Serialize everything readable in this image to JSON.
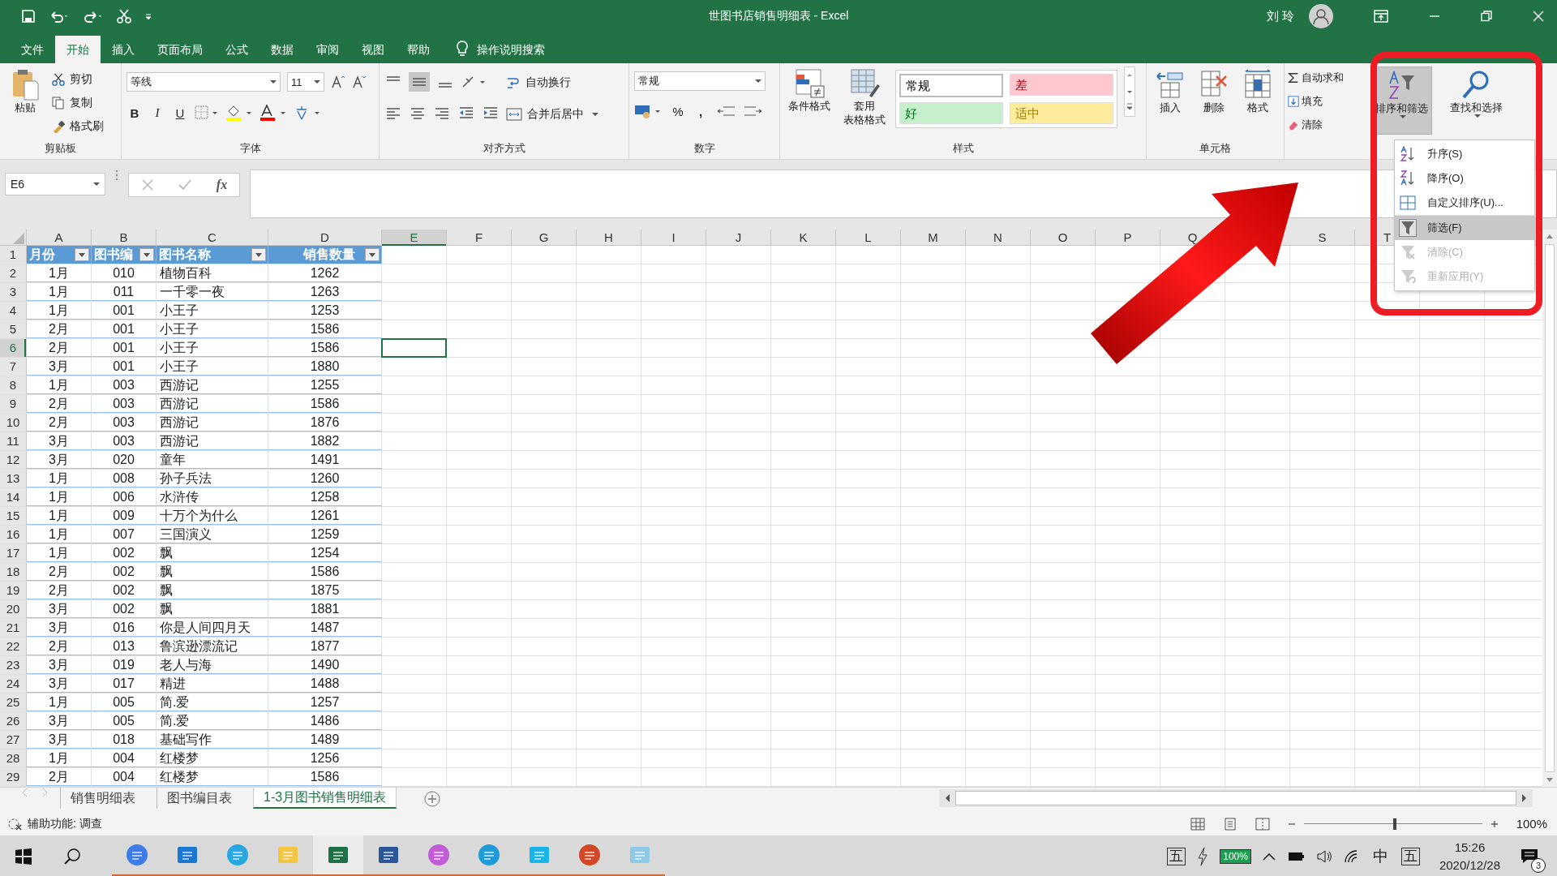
{
  "title_bar": {
    "title": "世图书店销售明细表  -  Excel",
    "user": "刘 玲"
  },
  "menu_tabs": [
    {
      "label": "文件",
      "selected": false
    },
    {
      "label": "开始",
      "selected": true
    },
    {
      "label": "插入",
      "selected": false
    },
    {
      "label": "页面布局",
      "selected": false
    },
    {
      "label": "公式",
      "selected": false
    },
    {
      "label": "数据",
      "selected": false
    },
    {
      "label": "审阅",
      "selected": false
    },
    {
      "label": "视图",
      "selected": false
    },
    {
      "label": "帮助",
      "selected": false
    }
  ],
  "tell_me": "操作说明搜索",
  "ribbon": {
    "clipboard": {
      "label": "剪贴板",
      "paste": "粘贴",
      "cut": "剪切",
      "copy": "复制",
      "painter": "格式刷"
    },
    "font": {
      "label": "字体",
      "family": "等线",
      "size": "11",
      "bold": "B",
      "italic": "I",
      "underline": "U"
    },
    "alignment": {
      "label": "对齐方式",
      "wrap": "自动换行",
      "merge": "合并后居中"
    },
    "number": {
      "label": "数字",
      "format": "常规",
      "percent": "%",
      "comma": ","
    },
    "styles": {
      "label": "样式",
      "conditional": "条件格式",
      "table_format": [
        "套用",
        "表格格式"
      ],
      "cell_styles": [
        {
          "label": "常规",
          "color": "#ffffff"
        },
        {
          "label": "差",
          "color": "#ffc7ce"
        },
        {
          "label": "好",
          "color": "#c6efce"
        },
        {
          "label": "适中",
          "color": "#ffeb9c"
        }
      ]
    },
    "cells": {
      "label": "单元格",
      "insert": "插入",
      "delete": "删除",
      "format": "格式"
    },
    "editing": {
      "autosum": "自动求和",
      "fill": "填充",
      "clear": "清除",
      "sort_filter": {
        "label": "排序和筛选",
        "pressed": true
      },
      "find": "查找和选择"
    }
  },
  "sort_menu": [
    {
      "label": "升序(S)",
      "kind": "ascending",
      "selected": false,
      "disabled": false
    },
    {
      "label": "降序(O)",
      "kind": "descending",
      "selected": false,
      "disabled": false
    },
    {
      "label": "自定义排序(U)...",
      "kind": "custom",
      "selected": false,
      "disabled": false
    },
    {
      "label": "筛选(F)",
      "kind": "filter",
      "selected": true,
      "disabled": false
    },
    {
      "label": "清除(C)",
      "kind": "clear",
      "selected": false,
      "disabled": true
    },
    {
      "label": "重新应用(Y)",
      "kind": "reapply",
      "selected": false,
      "disabled": true
    }
  ],
  "formula_bar": {
    "name_box": "E6",
    "fx": "fx"
  },
  "sheet": {
    "columns": [
      {
        "letter": "A",
        "selected": false
      },
      {
        "letter": "B",
        "selected": false
      },
      {
        "letter": "C",
        "selected": false
      },
      {
        "letter": "D",
        "selected": false
      },
      {
        "letter": "E",
        "selected": true
      },
      {
        "letter": "F",
        "selected": false
      },
      {
        "letter": "G",
        "selected": false
      },
      {
        "letter": "H",
        "selected": false
      },
      {
        "letter": "I",
        "selected": false
      },
      {
        "letter": "J",
        "selected": false
      },
      {
        "letter": "K",
        "selected": false
      },
      {
        "letter": "L",
        "selected": false
      },
      {
        "letter": "M",
        "selected": false
      },
      {
        "letter": "N",
        "selected": false
      },
      {
        "letter": "O",
        "selected": false
      },
      {
        "letter": "P",
        "selected": false
      },
      {
        "letter": "Q",
        "selected": false
      },
      {
        "letter": "S",
        "selected": false
      },
      {
        "letter": "T",
        "selected": false
      }
    ],
    "rows": [
      {
        "number": "1",
        "kind": "header",
        "selected": false,
        "cells": [
          "月份",
          "图书编",
          "图书名称",
          "销售数量"
        ]
      },
      {
        "number": "2",
        "kind": "data",
        "selected": false,
        "cells": [
          "1月",
          "010",
          "植物百科",
          "1262"
        ]
      },
      {
        "number": "3",
        "kind": "data",
        "selected": false,
        "cells": [
          "1月",
          "011",
          "一千零一夜",
          "1263"
        ]
      },
      {
        "number": "4",
        "kind": "data",
        "selected": false,
        "cells": [
          "1月",
          "001",
          "小王子",
          "1253"
        ]
      },
      {
        "number": "5",
        "kind": "data",
        "selected": false,
        "cells": [
          "2月",
          "001",
          "小王子",
          "1586"
        ]
      },
      {
        "number": "6",
        "kind": "data",
        "selected": true,
        "cells": [
          "2月",
          "001",
          "小王子",
          "1586"
        ]
      },
      {
        "number": "7",
        "kind": "data",
        "selected": false,
        "cells": [
          "3月",
          "001",
          "小王子",
          "1880"
        ]
      },
      {
        "number": "8",
        "kind": "data",
        "selected": false,
        "cells": [
          "1月",
          "003",
          "西游记",
          "1255"
        ]
      },
      {
        "number": "9",
        "kind": "data",
        "selected": false,
        "cells": [
          "2月",
          "003",
          "西游记",
          "1586"
        ]
      },
      {
        "number": "10",
        "kind": "data",
        "selected": false,
        "cells": [
          "2月",
          "003",
          "西游记",
          "1876"
        ]
      },
      {
        "number": "11",
        "kind": "data",
        "selected": false,
        "cells": [
          "3月",
          "003",
          "西游记",
          "1882"
        ]
      },
      {
        "number": "12",
        "kind": "data",
        "selected": false,
        "cells": [
          "3月",
          "020",
          "童年",
          "1491"
        ]
      },
      {
        "number": "13",
        "kind": "data",
        "selected": false,
        "cells": [
          "1月",
          "008",
          "孙子兵法",
          "1260"
        ]
      },
      {
        "number": "14",
        "kind": "data",
        "selected": false,
        "cells": [
          "1月",
          "006",
          "水浒传",
          "1258"
        ]
      },
      {
        "number": "15",
        "kind": "data",
        "selected": false,
        "cells": [
          "1月",
          "009",
          "十万个为什么",
          "1261"
        ]
      },
      {
        "number": "16",
        "kind": "data",
        "selected": false,
        "cells": [
          "1月",
          "007",
          "三国演义",
          "1259"
        ]
      },
      {
        "number": "17",
        "kind": "data",
        "selected": false,
        "cells": [
          "1月",
          "002",
          "飘",
          "1254"
        ]
      },
      {
        "number": "18",
        "kind": "data",
        "selected": false,
        "cells": [
          "2月",
          "002",
          "飘",
          "1586"
        ]
      },
      {
        "number": "19",
        "kind": "data",
        "selected": false,
        "cells": [
          "2月",
          "002",
          "飘",
          "1875"
        ]
      },
      {
        "number": "20",
        "kind": "data",
        "selected": false,
        "cells": [
          "3月",
          "002",
          "飘",
          "1881"
        ]
      },
      {
        "number": "21",
        "kind": "data",
        "selected": false,
        "cells": [
          "3月",
          "016",
          "你是人间四月天",
          "1487"
        ]
      },
      {
        "number": "22",
        "kind": "data",
        "selected": false,
        "cells": [
          "2月",
          "013",
          "鲁滨逊漂流记",
          "1877"
        ]
      },
      {
        "number": "23",
        "kind": "data",
        "selected": false,
        "cells": [
          "3月",
          "019",
          "老人与海",
          "1490"
        ]
      },
      {
        "number": "24",
        "kind": "data",
        "selected": false,
        "cells": [
          "3月",
          "017",
          "精进",
          "1488"
        ]
      },
      {
        "number": "25",
        "kind": "data",
        "selected": false,
        "cells": [
          "1月",
          "005",
          "简.爱",
          "1257"
        ]
      },
      {
        "number": "26",
        "kind": "data",
        "selected": false,
        "cells": [
          "3月",
          "005",
          "简.爱",
          "1486"
        ]
      },
      {
        "number": "27",
        "kind": "data",
        "selected": false,
        "cells": [
          "3月",
          "018",
          "基础写作",
          "1489"
        ]
      },
      {
        "number": "28",
        "kind": "data",
        "selected": false,
        "cells": [
          "1月",
          "004",
          "红楼梦",
          "1256"
        ]
      },
      {
        "number": "29",
        "kind": "data",
        "selected": false,
        "cells": [
          "2月",
          "004",
          "红楼梦",
          "1586"
        ]
      }
    ]
  },
  "sheet_tabs": [
    {
      "label": "销售明细表",
      "selected": false
    },
    {
      "label": "图书编目表",
      "selected": false
    },
    {
      "label": "1-3月图书销售明细表",
      "selected": true
    }
  ],
  "status_bar": {
    "accessibility": "辅助功能: 调查",
    "zoom_slider": {
      "level": 0.5
    },
    "zoom": "100%"
  },
  "taskbar": {
    "apps": [
      {
        "kind": "circle-l",
        "selected": false
      },
      {
        "kind": "mail",
        "selected": false
      },
      {
        "kind": "circle-e",
        "selected": false
      },
      {
        "kind": "folder",
        "selected": false
      },
      {
        "kind": "excel",
        "selected": true
      },
      {
        "kind": "word",
        "selected": false
      },
      {
        "kind": "paint",
        "selected": false
      },
      {
        "kind": "edge",
        "selected": false
      },
      {
        "kind": "square-app",
        "selected": false
      },
      {
        "kind": "powerpoint",
        "selected": false
      },
      {
        "kind": "notepad",
        "selected": false
      }
    ],
    "ime": "五",
    "battery": "100%",
    "language": "中",
    "ime_mode": "五",
    "time": "15:26",
    "date": "2020/12/28",
    "notifications": "3"
  }
}
